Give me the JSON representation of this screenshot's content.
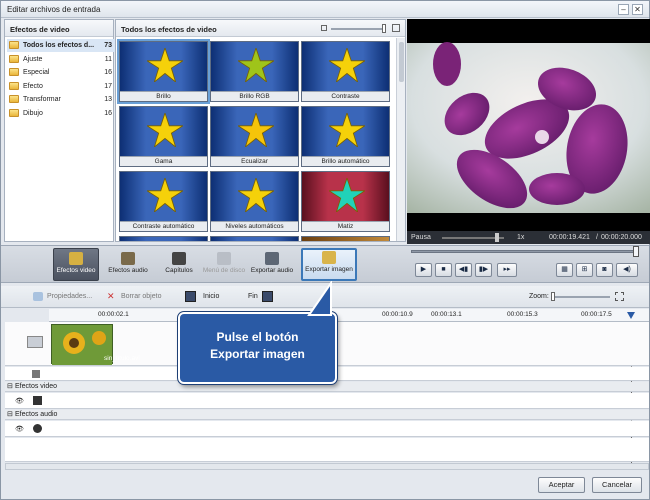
{
  "window": {
    "title": "Editar archivos de entrada"
  },
  "categories_panel": {
    "header": "Efectos de video",
    "items": [
      {
        "label": "Todos los efectos d...",
        "count": "73"
      },
      {
        "label": "Ajuste",
        "count": "11"
      },
      {
        "label": "Especial",
        "count": "16"
      },
      {
        "label": "Efecto",
        "count": "17"
      },
      {
        "label": "Transformar",
        "count": "13"
      },
      {
        "label": "Dibujo",
        "count": "16"
      }
    ]
  },
  "effects_panel": {
    "header": "Todos los efectos de video",
    "tiles": [
      {
        "label": "Brillo",
        "star": "#f5d10a",
        "bg": "blue"
      },
      {
        "label": "Brillo RGB",
        "star": "#9fc41a",
        "bg": "blue"
      },
      {
        "label": "Contraste",
        "star": "#f5d10a",
        "bg": "blue"
      },
      {
        "label": "Gama",
        "star": "#f5d10a",
        "bg": "blue"
      },
      {
        "label": "Ecualizar",
        "star": "#f5c40a",
        "bg": "blue"
      },
      {
        "label": "Brillo automático",
        "star": "#f5d10a",
        "bg": "blue"
      },
      {
        "label": "Contraste automático",
        "star": "#f5d10a",
        "bg": "blue"
      },
      {
        "label": "Niveles automáticos",
        "star": "#f5d10a",
        "bg": "blue"
      },
      {
        "label": "Matiz",
        "star": "#21d2b8",
        "bg": "red"
      }
    ]
  },
  "player": {
    "status": "Pausa",
    "speed": "1x",
    "position": "00:00:19.421",
    "duration": "00:00:20.000",
    "separator": "/"
  },
  "toolbar": {
    "video_effects": "Efectos video",
    "audio_effects": "Efectos audio",
    "chapters": "Capítulos",
    "disc_menu": "Menú de disco",
    "export_audio": "Exportar audio",
    "export_image": "Exportar imagen"
  },
  "timeline_tools": {
    "properties": "Propiedades...",
    "delete_object": "Borrar objeto",
    "start": "Inicio",
    "end": "Fin",
    "zoom": "Zoom:"
  },
  "ruler": [
    "00:00:02.1",
    "00:00:10.9",
    "00:00:13.1",
    "00:00:15.3",
    "00:00:17.5"
  ],
  "tracks": {
    "clip_name": "sin_titulo.avi",
    "video_effects_section": "Efectos video",
    "audio_effects_section": "Efectos audio"
  },
  "callout": {
    "line1": "Pulse el botón",
    "line2": "Exportar imagen"
  },
  "footer": {
    "ok": "Aceptar",
    "cancel": "Cancelar"
  }
}
